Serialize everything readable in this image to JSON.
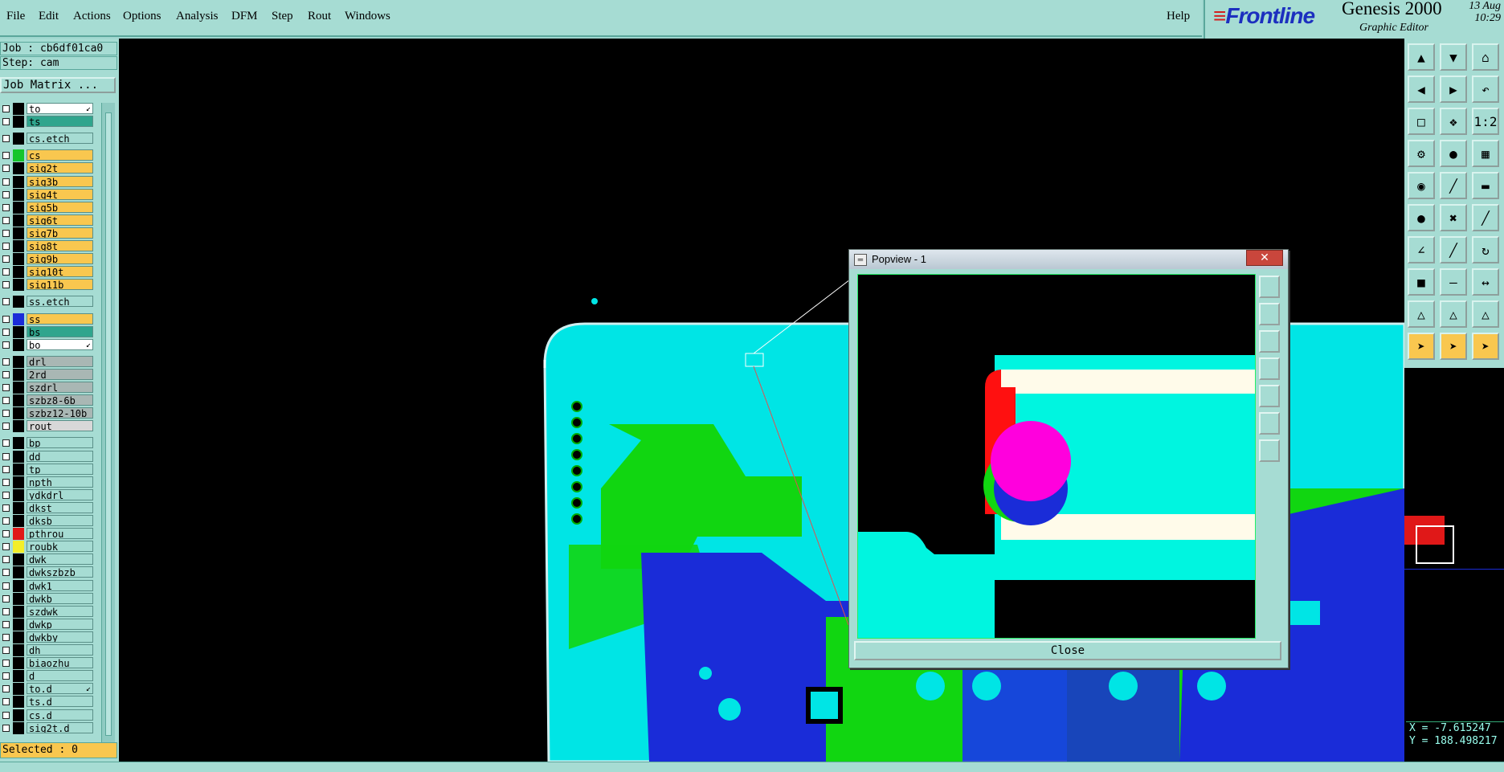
{
  "menubar": {
    "items": [
      "File",
      "Edit",
      "Actions",
      "Options",
      "Analysis",
      "DFM",
      "Step",
      "Rout",
      "Windows"
    ],
    "help": "Help"
  },
  "brand": {
    "logo": "Frontline",
    "product": "Genesis 2000",
    "subtitle": "Graphic Editor",
    "date": "13 Aug",
    "time": "10:29"
  },
  "left": {
    "job": "Job : cb6df01ca0",
    "step": "Step: cam",
    "job_matrix": "Job Matrix ...",
    "selected": "Selected : 0",
    "layers": [
      {
        "name": "to",
        "color": "#ffffff",
        "swatch": "#000000",
        "arrow": true
      },
      {
        "name": "ts",
        "color": "#2fa58d",
        "swatch": "#000000",
        "arrow": false
      },
      {
        "name": "cs.etch",
        "color": "#a6dcd3",
        "swatch": "#000000",
        "arrow": false,
        "gap": true
      },
      {
        "name": "cs",
        "color": "#f9c74f",
        "swatch": "#16c52c",
        "arrow": false,
        "gap": true
      },
      {
        "name": "sig2t",
        "color": "#f9c74f",
        "swatch": "#000000",
        "arrow": false
      },
      {
        "name": "sig3b",
        "color": "#f9c74f",
        "swatch": "#000000",
        "arrow": false
      },
      {
        "name": "sig4t",
        "color": "#f9c74f",
        "swatch": "#000000",
        "arrow": false
      },
      {
        "name": "sig5b",
        "color": "#f9c74f",
        "swatch": "#000000",
        "arrow": false
      },
      {
        "name": "sig6t",
        "color": "#f9c74f",
        "swatch": "#000000",
        "arrow": false
      },
      {
        "name": "sig7b",
        "color": "#f9c74f",
        "swatch": "#000000",
        "arrow": false
      },
      {
        "name": "sig8t",
        "color": "#f9c74f",
        "swatch": "#000000",
        "arrow": false
      },
      {
        "name": "sig9b",
        "color": "#f9c74f",
        "swatch": "#000000",
        "arrow": false
      },
      {
        "name": "sig10t",
        "color": "#f9c74f",
        "swatch": "#000000",
        "arrow": false
      },
      {
        "name": "sig11b",
        "color": "#f9c74f",
        "swatch": "#000000",
        "arrow": false
      },
      {
        "name": "ss.etch",
        "color": "#a6dcd3",
        "swatch": "#000000",
        "arrow": false,
        "gap": true
      },
      {
        "name": "ss",
        "color": "#f9c74f",
        "swatch": "#1a2cd8",
        "arrow": false,
        "gap": true
      },
      {
        "name": "bs",
        "color": "#2fa58d",
        "swatch": "#000000",
        "arrow": false
      },
      {
        "name": "bo",
        "color": "#ffffff",
        "swatch": "#000000",
        "arrow": true
      },
      {
        "name": "drl",
        "color": "#a9b7b4",
        "swatch": "#000000",
        "arrow": false,
        "gap": true
      },
      {
        "name": "2rd",
        "color": "#a9b7b4",
        "swatch": "#000000",
        "arrow": false
      },
      {
        "name": "szdrl",
        "color": "#a9b7b4",
        "swatch": "#000000",
        "arrow": false
      },
      {
        "name": "szbz8-6b",
        "color": "#a9b7b4",
        "swatch": "#000000",
        "arrow": false
      },
      {
        "name": "szbz12-10b",
        "color": "#a9b7b4",
        "swatch": "#000000",
        "arrow": false
      },
      {
        "name": "rout",
        "color": "#d8d8d8",
        "swatch": "#000000",
        "arrow": false
      },
      {
        "name": "bp",
        "color": "#a6dcd3",
        "swatch": "#000000",
        "arrow": false,
        "gap": true
      },
      {
        "name": "dd",
        "color": "#a6dcd3",
        "swatch": "#000000",
        "arrow": false
      },
      {
        "name": "tp",
        "color": "#a6dcd3",
        "swatch": "#000000",
        "arrow": false
      },
      {
        "name": "npth",
        "color": "#a6dcd3",
        "swatch": "#000000",
        "arrow": false
      },
      {
        "name": "ydkdrl",
        "color": "#a6dcd3",
        "swatch": "#000000",
        "arrow": false
      },
      {
        "name": "dkst",
        "color": "#a6dcd3",
        "swatch": "#000000",
        "arrow": false
      },
      {
        "name": "dksb",
        "color": "#a6dcd3",
        "swatch": "#000000",
        "arrow": false
      },
      {
        "name": "pthrou",
        "color": "#a6dcd3",
        "swatch": "#e01818",
        "arrow": false
      },
      {
        "name": "roubk",
        "color": "#a6dcd3",
        "swatch": "#f3ee2a",
        "arrow": false
      },
      {
        "name": "dwk",
        "color": "#a6dcd3",
        "swatch": "#000000",
        "arrow": false
      },
      {
        "name": "dwkszbzb",
        "color": "#a6dcd3",
        "swatch": "#000000",
        "arrow": false
      },
      {
        "name": "dwk1",
        "color": "#a6dcd3",
        "swatch": "#000000",
        "arrow": false
      },
      {
        "name": "dwkb",
        "color": "#a6dcd3",
        "swatch": "#000000",
        "arrow": false
      },
      {
        "name": "szdwk",
        "color": "#a6dcd3",
        "swatch": "#000000",
        "arrow": false
      },
      {
        "name": "dwkp",
        "color": "#a6dcd3",
        "swatch": "#000000",
        "arrow": false
      },
      {
        "name": "dwkby",
        "color": "#a6dcd3",
        "swatch": "#000000",
        "arrow": false
      },
      {
        "name": "dh",
        "color": "#a6dcd3",
        "swatch": "#000000",
        "arrow": false
      },
      {
        "name": "biaozhu",
        "color": "#a6dcd3",
        "swatch": "#000000",
        "arrow": false
      },
      {
        "name": "d",
        "color": "#a6dcd3",
        "swatch": "#000000",
        "arrow": false
      },
      {
        "name": "to.d",
        "color": "#a6dcd3",
        "swatch": "#000000",
        "arrow": true
      },
      {
        "name": "ts.d",
        "color": "#a6dcd3",
        "swatch": "#000000",
        "arrow": false
      },
      {
        "name": "cs.d",
        "color": "#a6dcd3",
        "swatch": "#000000",
        "arrow": false
      },
      {
        "name": "sig2t.d",
        "color": "#a6dcd3",
        "swatch": "#000000",
        "arrow": false
      }
    ]
  },
  "popview": {
    "title": "Popview - 1",
    "close_label": "Close",
    "close_glyph": "✕"
  },
  "coords": {
    "x": "X = -7.615247",
    "y": "Y = 188.498217"
  },
  "tools": {
    "icons": [
      "layers-up-icon",
      "layers-down-icon",
      "home-icon",
      "step-left-icon",
      "step-right-icon",
      "undo-view-icon",
      "zoom-fit-icon",
      "zoom-center-icon",
      "scale-1-2-icon",
      "snap-icon",
      "measure-pad-icon",
      "net-icon",
      "select-pad-icon",
      "draw-line-icon",
      "ruler-icon",
      "node-icon",
      "delete-node-icon",
      "edge-icon",
      "angle-icon",
      "slash-icon",
      "rotate-icon",
      "pad-red-icon",
      "minus-icon",
      "stretch-icon",
      "triangle-icon",
      "triangle-a-icon",
      "triangle-b-icon",
      "pointer-icon",
      "pointer-select-icon",
      "pointer-target-icon"
    ]
  }
}
